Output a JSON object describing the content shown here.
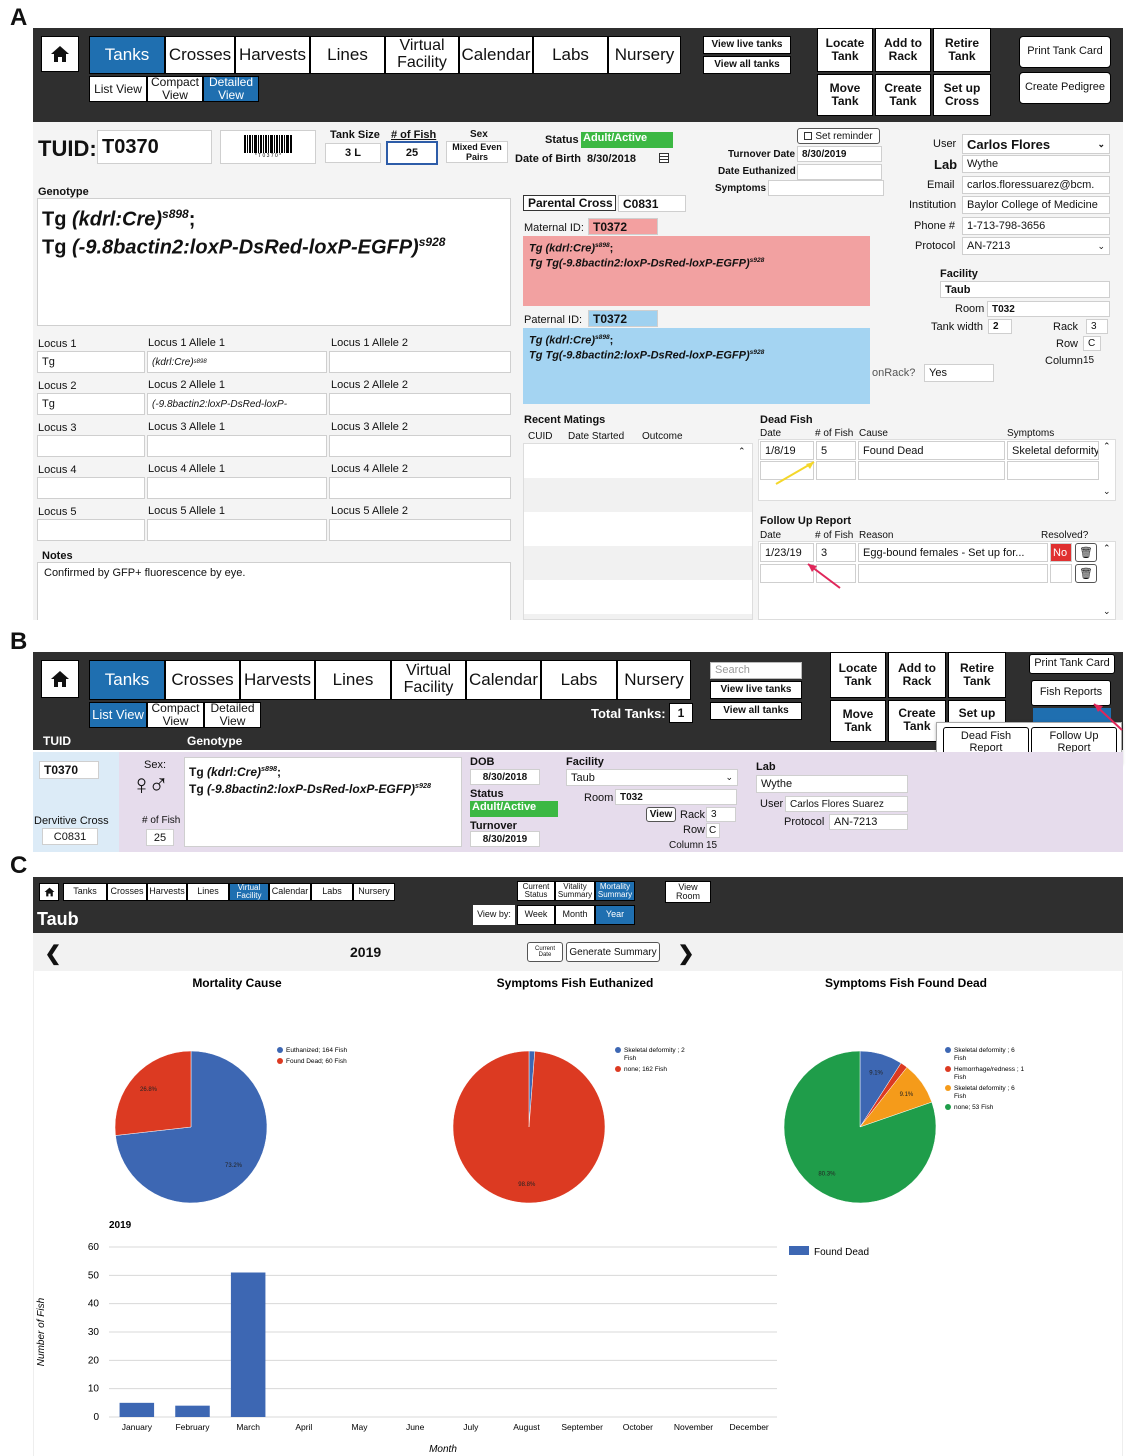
{
  "panels": {
    "a": "A",
    "b": "B",
    "c": "C"
  },
  "panelA": {
    "nav": {
      "tabs": [
        "Tanks",
        "Crosses",
        "Harvests",
        "Lines",
        "Virtual\nFacility",
        "Calendar",
        "Labs",
        "Nursery"
      ],
      "subviews": [
        "List View",
        "Compact\nView",
        "Detailed\nView"
      ],
      "view_live": "View live tanks",
      "view_all": "View all tanks",
      "actions": [
        "Locate\nTank",
        "Add to\nRack",
        "Retire\nTank",
        "Move\nTank",
        "Create\nTank",
        "Set up\nCross"
      ],
      "print_card": "Print Tank Card",
      "create_pedigree": "Create Pedigree"
    },
    "tuid_label": "TUID:",
    "tuid": "T0370",
    "barcode_text": "* T 0 3 7 0 *",
    "tank_size_label": "Tank Size",
    "tank_size": "3 L",
    "num_fish_label": "# of Fish",
    "num_fish": "25",
    "sex_label": "Sex",
    "sex_value": "Mixed Even\nPairs",
    "status_label": "Status",
    "status": "Adult/Active",
    "dob_label": "Date of Birth",
    "dob": "8/30/2018",
    "set_reminder": "Set reminder",
    "turnover_label": "Turnover Date",
    "turnover": "8/30/2019",
    "euthanized_label": "Date Euthanized",
    "symptoms_label": "Symptoms",
    "user_label": "User",
    "user": "Carlos Flores",
    "lab_label": "Lab",
    "lab": "Wythe",
    "email_label": "Email",
    "email": "carlos.floressuarez@bcm.",
    "institution_label": "Institution",
    "institution": "Baylor College of Medicine",
    "phone_label": "Phone #",
    "phone": "1-713-798-3656",
    "protocol_label": "Protocol",
    "protocol": "AN-7213",
    "genotype_label": "Genotype",
    "geno1_pre": "Tg ",
    "geno1_it": "(kdrl:Cre)",
    "geno1_sup": "s898",
    "geno1_post": ";",
    "geno2_pre": "Tg ",
    "geno2_it": "(-9.8bactin2:loxP-DsRed-loxP-EGFP)",
    "geno2_sup": "s928",
    "parental_cross_label": "Parental Cross",
    "parental_cross": "C0831",
    "maternal_label": "Maternal ID:",
    "maternal_id": "T0372",
    "maternal_line1": "Tg (kdrl:Cre)",
    "maternal_line1_sup": "s898",
    "maternal_line1_post": ";",
    "maternal_line2": "Tg Tg(-9.8bactin2:loxP-DsRed-loxP-EGFP)",
    "maternal_line2_sup": "s928",
    "paternal_label": "Paternal ID:",
    "paternal_id": "T0372",
    "paternal_line1": "Tg (kdrl:Cre)",
    "paternal_line1_sup": "s898",
    "paternal_line1_post": ";",
    "paternal_line2": "Tg Tg(-9.8bactin2:loxP-DsRed-loxP-EGFP)",
    "paternal_line2_sup": "s928",
    "facility_label": "Facility",
    "facility": "Taub",
    "room_label": "Room",
    "room": "T032",
    "tank_width_label": "Tank width",
    "tank_width": "2",
    "rack_label": "Rack",
    "rack": "3",
    "row_label": "Row",
    "row": "C",
    "column_label": "Column",
    "column": "15",
    "onrack_label": "onRack?",
    "onrack": "Yes",
    "loci": [
      {
        "label": "Locus 1",
        "value": "Tg",
        "a1_label": "Locus 1 Allele 1",
        "a1": "(kdrl:Cre)",
        "a1_sup": "s898",
        "a2_label": "Locus 1 Allele 2"
      },
      {
        "label": "Locus 2",
        "value": "Tg",
        "a1_label": "Locus 2 Allele 1",
        "a1": "(-9.8bactin2:loxP-DsRed-loxP-",
        "a1_sup": "",
        "a2_label": "Locus 2 Allele 2"
      },
      {
        "label": "Locus 3",
        "value": "",
        "a1_label": "Locus 3 Allele 1",
        "a1": "",
        "a1_sup": "",
        "a2_label": "Locus 3 Allele 2"
      },
      {
        "label": "Locus 4",
        "value": "",
        "a1_label": "Locus 4 Allele 1",
        "a1": "",
        "a1_sup": "",
        "a2_label": "Locus 4 Allele 2"
      },
      {
        "label": "Locus 5",
        "value": "",
        "a1_label": "Locus 5 Allele 1",
        "a1": "",
        "a1_sup": "",
        "a2_label": "Locus 5 Allele 2"
      }
    ],
    "notes_label": "Notes",
    "notes": "Confirmed by  GFP+ fluorescence by eye.",
    "recent_matings_label": "Recent Matings",
    "matings_cols": [
      "CUID",
      "Date Started",
      "Outcome"
    ],
    "dead_fish_label": "Dead Fish",
    "dead_cols": [
      "Date",
      "# of Fish",
      "Cause",
      "Symptoms"
    ],
    "dead_row": {
      "date": "1/8/19",
      "count": "5",
      "cause": "Found Dead",
      "symptoms": "Skeletal deformity"
    },
    "followup_label": "Follow Up Report",
    "followup_cols": [
      "Date",
      "# of Fish",
      "Reason",
      "Resolved?"
    ],
    "followup_row": {
      "date": "1/23/19",
      "count": "3",
      "reason": "Egg-bound females - Set up for...",
      "resolved": "No"
    }
  },
  "panelB": {
    "tabs": [
      "Tanks",
      "Crosses",
      "Harvests",
      "Lines",
      "Virtual\nFacility",
      "Calendar",
      "Labs",
      "Nursery"
    ],
    "subviews": [
      "List View",
      "Compact\nView",
      "Detailed\nView"
    ],
    "search_placeholder": "Search",
    "view_live": "View live tanks",
    "view_all": "View all tanks",
    "total_tanks_label": "Total Tanks:",
    "total_tanks": "1",
    "actions": [
      "Locate\nTank",
      "Add to\nRack",
      "Retire\nTank",
      "Move\nTank",
      "Create\nTank",
      "Set up"
    ],
    "print_card": "Print Tank Card",
    "fish_reports": "Fish Reports",
    "dead_fish_report": "Dead Fish\nReport",
    "followup_report": "Follow Up\nReport",
    "col_tuid": "TUID",
    "col_genotype": "Genotype",
    "tuid": "T0370",
    "derivative_label": "Dervitive Cross",
    "derivative": "C0831",
    "sex_label": "Sex:",
    "sex_symbols": "♀♂",
    "num_fish_label": "# of Fish",
    "num_fish": "25",
    "geno1_pre": "Tg ",
    "geno1_it": "(kdrl:Cre)",
    "geno1_sup": "s898",
    "geno1_post": ";",
    "geno2_pre": "Tg ",
    "geno2_it": "(-9.8bactin2:loxP-DsRed-loxP-EGFP)",
    "geno2_sup": "s928",
    "dob_label": "DOB",
    "dob": "8/30/2018",
    "status_label": "Status",
    "status": "Adult/Active",
    "turnover_label": "Turnover",
    "turnover": "8/30/2019",
    "facility_label": "Facility",
    "facility": "Taub",
    "room_label": "Room",
    "room": "T032",
    "view_btn": "View",
    "rack_label": "Rack",
    "rack": "3",
    "row_label": "Row",
    "row": "C",
    "column_label": "Column",
    "column": "15",
    "lab_label": "Lab",
    "lab": "Wythe",
    "user_label": "User",
    "user": "Carlos Flores Suarez",
    "protocol_label": "Protocol",
    "protocol": "AN-7213"
  },
  "panelC": {
    "tabs": [
      "Tanks",
      "Crosses",
      "Harvests",
      "Lines",
      "Virtual\nFacility",
      "Calendar",
      "Labs",
      "Nursery"
    ],
    "summary_tabs": [
      "Current\nStatus",
      "Vitality\nSummary",
      "Mortality\nSummary"
    ],
    "view_room": "View\nRoom",
    "view_by_label": "View by:",
    "view_by": [
      "Week",
      "Month",
      "Year"
    ],
    "facility": "Taub",
    "year": "2019",
    "current_date": "Current\nDate",
    "generate_summary": "Generate Summary",
    "colors": {
      "blue": "#3d67b3",
      "red": "#dc3a22",
      "green": "#1f9d4a",
      "orange": "#f59b1a"
    }
  },
  "chart_data": [
    {
      "type": "pie",
      "title": "Mortality Cause",
      "labels": [
        "Euthanized; 164 Fish",
        "Found Dead; 60 Fish"
      ],
      "values": [
        164,
        60
      ],
      "percent_labels": [
        "73.2%",
        "26.8%"
      ],
      "colors": [
        "#3d67b3",
        "#dc3a22"
      ]
    },
    {
      "type": "pie",
      "title": "Symptoms Fish Euthanized",
      "labels": [
        "Skeletal deformity ; 2 Fish",
        "none; 162 Fish"
      ],
      "values": [
        2,
        162
      ],
      "percent_labels": [
        "",
        "98.8%"
      ],
      "colors": [
        "#3d67b3",
        "#dc3a22"
      ]
    },
    {
      "type": "pie",
      "title": "Symptoms Fish Found Dead",
      "labels": [
        "Skeletal deformity ; 6 Fish",
        "Hemorrhage/redness ; 1 Fish",
        "Skeletal deformity ; 6 Fish",
        "none; 53 Fish"
      ],
      "values": [
        6,
        1,
        6,
        53
      ],
      "percent_labels": [
        "9.1%",
        "",
        "9.1%",
        "80.3%"
      ],
      "colors": [
        "#3d67b3",
        "#dc3a22",
        "#f59b1a",
        "#1f9d4a"
      ]
    },
    {
      "type": "bar",
      "title": "2019",
      "xlabel": "Month",
      "ylabel": "Number of Fish",
      "categories": [
        "January",
        "February",
        "March",
        "April",
        "May",
        "June",
        "July",
        "August",
        "September",
        "October",
        "November",
        "December"
      ],
      "series": [
        {
          "name": "Found Dead",
          "values": [
            5,
            4,
            51,
            0,
            0,
            0,
            0,
            0,
            0,
            0,
            0,
            0
          ]
        }
      ],
      "ylim": [
        0,
        60
      ],
      "yticks": [
        0,
        10,
        20,
        30,
        40,
        50,
        60
      ],
      "color": "#3d67b3"
    }
  ]
}
